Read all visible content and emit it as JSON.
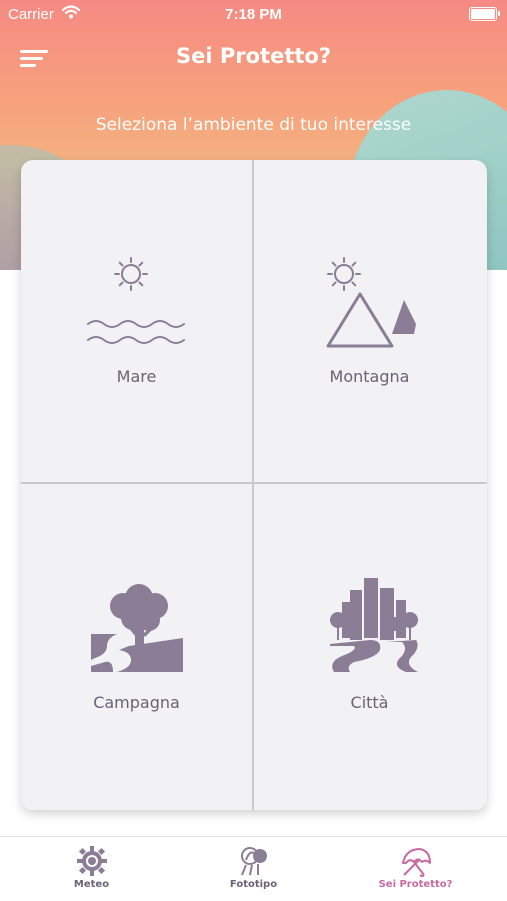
{
  "status_bar": {
    "carrier": "Carrier",
    "time": "7:18 PM"
  },
  "header": {
    "title": "Sei Protetto?",
    "subtitle": "Seleziona l’ambiente di tuo interesse"
  },
  "environments": [
    {
      "label": "Mare",
      "icon": "sea-icon"
    },
    {
      "label": "Montagna",
      "icon": "mountain-icon"
    },
    {
      "label": "Campagna",
      "icon": "countryside-icon"
    },
    {
      "label": "Città",
      "icon": "city-icon"
    }
  ],
  "tabs": [
    {
      "label": "Meteo",
      "icon": "sun-gear-icon",
      "active": false
    },
    {
      "label": "Fototipo",
      "icon": "phototype-icon",
      "active": false
    },
    {
      "label": "Sei Protetto?",
      "icon": "umbrella-icon",
      "active": true
    }
  ],
  "colors": {
    "icon": "#8a7d95",
    "label": "#6b6275",
    "active_tab": "#c56ba2",
    "header_gradient_top": "#f58a84",
    "header_gradient_bottom": "#d97e87"
  }
}
